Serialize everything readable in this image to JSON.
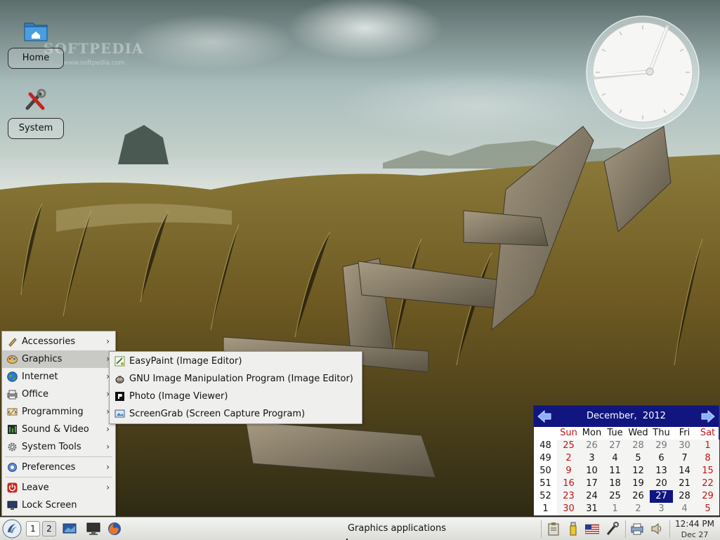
{
  "desktop": {
    "icons": [
      {
        "label": "Home",
        "icon": "folder-home-icon"
      },
      {
        "label": "System",
        "icon": "tools-icon"
      }
    ],
    "watermark": "SOFTPEDIA",
    "watermark_sub": "www.softpedia.com"
  },
  "start_menu": {
    "items": [
      {
        "label": "Accessories",
        "icon": "accessories-icon",
        "has_submenu": true
      },
      {
        "label": "Graphics",
        "icon": "graphics-icon",
        "has_submenu": true,
        "active": true
      },
      {
        "label": "Internet",
        "icon": "globe-icon",
        "has_submenu": true
      },
      {
        "label": "Office",
        "icon": "office-icon",
        "has_submenu": true
      },
      {
        "label": "Programming",
        "icon": "programming-icon",
        "has_submenu": true
      },
      {
        "label": "Sound & Video",
        "icon": "multimedia-icon",
        "has_submenu": true
      },
      {
        "label": "System Tools",
        "icon": "system-tools-icon",
        "has_submenu": true
      },
      {
        "label": "Preferences",
        "icon": "preferences-icon",
        "has_submenu": true
      },
      {
        "label": "Leave",
        "icon": "power-icon",
        "has_submenu": true
      },
      {
        "label": "Lock Screen",
        "icon": "lock-screen-icon",
        "has_submenu": false
      }
    ],
    "arrow": "›"
  },
  "graphics_submenu": {
    "items": [
      {
        "label": "EasyPaint (Image Editor)",
        "icon": "easypaint-icon"
      },
      {
        "label": "GNU Image Manipulation Program (Image Editor)",
        "icon": "gimp-icon"
      },
      {
        "label": "Photo (Image Viewer)",
        "icon": "photo-viewer-icon"
      },
      {
        "label": "ScreenGrab (Screen Capture Program)",
        "icon": "screengrab-icon"
      }
    ]
  },
  "calendar": {
    "month": "December",
    "year": "2012",
    "weekdays": [
      "Sun",
      "Mon",
      "Tue",
      "Wed",
      "Thu",
      "Fri",
      "Sat"
    ],
    "weeks": [
      {
        "week": "48",
        "days": [
          "25",
          "26",
          "27",
          "28",
          "29",
          "30",
          "1"
        ]
      },
      {
        "week": "49",
        "days": [
          "2",
          "3",
          "4",
          "5",
          "6",
          "7",
          "8"
        ]
      },
      {
        "week": "50",
        "days": [
          "9",
          "10",
          "11",
          "12",
          "13",
          "14",
          "15"
        ]
      },
      {
        "week": "51",
        "days": [
          "16",
          "17",
          "18",
          "19",
          "20",
          "21",
          "22"
        ]
      },
      {
        "week": "52",
        "days": [
          "23",
          "24",
          "25",
          "26",
          "27",
          "28",
          "29"
        ]
      },
      {
        "week": "1",
        "days": [
          "30",
          "31",
          "1",
          "2",
          "3",
          "4",
          "5"
        ]
      }
    ],
    "today": "27",
    "colors": {
      "header": "#10157f",
      "weekend": "#c01515",
      "today_bg": "#10157f"
    }
  },
  "taskbar": {
    "desktops": [
      "1",
      "2"
    ],
    "active_task": "Graphics applications",
    "time": "12:44 PM",
    "date": "Dec 27",
    "tray_icons": [
      "clipboard-icon",
      "usb-icon",
      "keyboard-layout-flag-icon",
      "network-tool-icon",
      "printer-icon",
      "volume-icon"
    ]
  }
}
